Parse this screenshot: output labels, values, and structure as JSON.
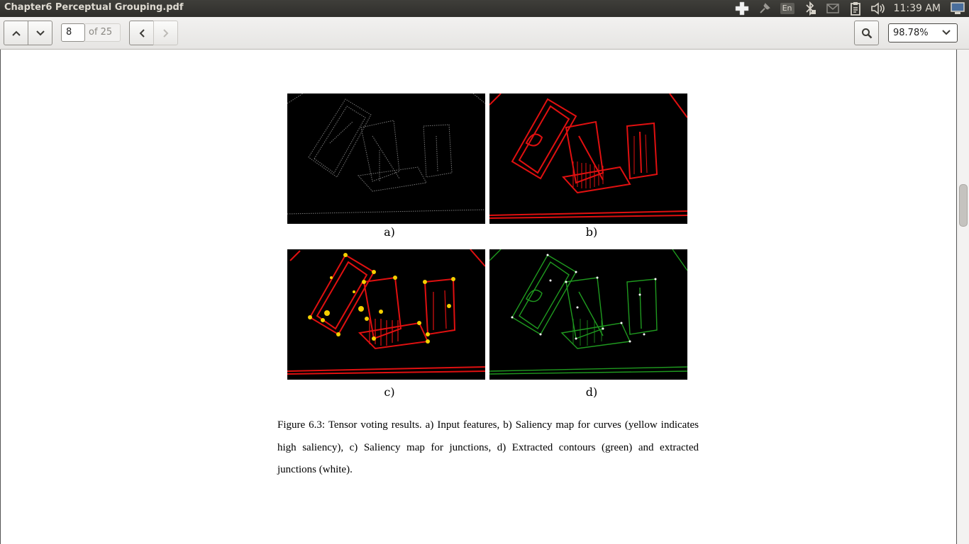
{
  "window": {
    "title": "Chapter6 Perceptual Grouping.pdf"
  },
  "tray": {
    "icons": [
      "health-cross-icon",
      "network-pin-icon",
      "keyboard-layout-indicator",
      "bluetooth-icon",
      "mail-icon",
      "battery-clipboard-icon",
      "volume-icon",
      "session-computer-icon"
    ],
    "keyboard_layout": "En",
    "clock": "11:39 AM"
  },
  "toolbar": {
    "current_page": "8",
    "page_total": "of 25",
    "zoom": "98.78%",
    "icons": {
      "prev_page": "chevron-up-icon",
      "next_page": "chevron-down-icon",
      "back": "chevron-left-icon",
      "forward": "chevron-right-icon",
      "search": "search-icon",
      "zoom_dropdown": "chevron-down-icon"
    }
  },
  "document": {
    "subfigures": [
      {
        "label": "a)",
        "description_color": "gray"
      },
      {
        "label": "b)",
        "description_color": "red"
      },
      {
        "label": "c)",
        "description_color": "red-yellow"
      },
      {
        "label": "d)",
        "description_color": "green"
      }
    ],
    "caption": "Figure 6.3: Tensor voting results. a) Input features, b) Saliency map for curves (yellow indicates high saliency), c) Saliency map for junctions, d) Extracted contours (green) and extracted junctions (white)."
  },
  "colors": {
    "panel_bg": "#3c3b37",
    "toolbar_bg": "#edecea",
    "saliency_red": "#e01010",
    "saliency_yellow": "#f5d000",
    "contour_green": "#1f9a1f",
    "input_gray": "#7a7a7a"
  }
}
